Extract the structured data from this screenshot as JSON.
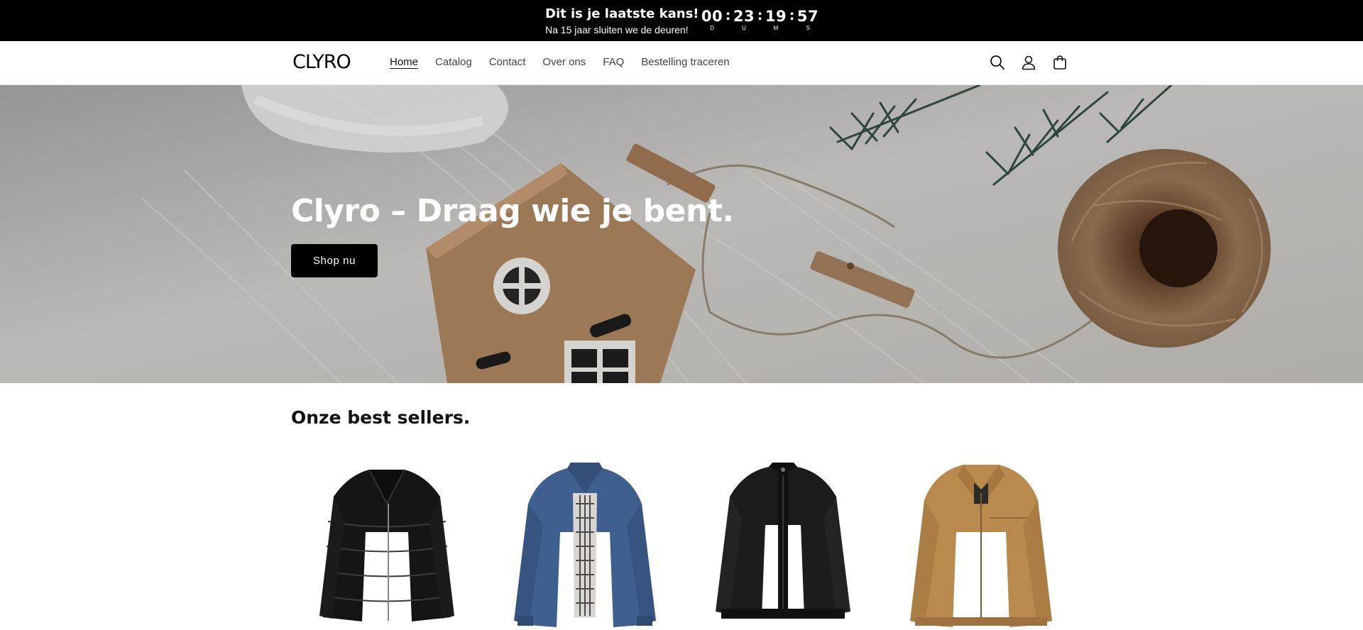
{
  "announcement": {
    "title": "Dit is je laatste kans!",
    "subtitle": "Na 15 jaar sluiten we de deuren!",
    "countdown": [
      {
        "value": "00",
        "label": "D"
      },
      {
        "value": "23",
        "label": "U"
      },
      {
        "value": "19",
        "label": "M"
      },
      {
        "value": "57",
        "label": "S"
      }
    ],
    "separator": ":"
  },
  "header": {
    "logo": "CLYRO",
    "nav": [
      "Home",
      "Catalog",
      "Contact",
      "Over ons",
      "FAQ",
      "Bestelling traceren"
    ],
    "active_nav": "Home",
    "icons": [
      "search-icon",
      "account-icon",
      "cart-icon"
    ]
  },
  "hero": {
    "title": "Clyro – Draag wie je bent.",
    "button": "Shop nu"
  },
  "bestsellers": {
    "title": "Onze best sellers.",
    "products": [
      {
        "name": "black-puffer-jacket",
        "color": "#151515"
      },
      {
        "name": "blue-bomber-jacket",
        "color": "#3f5f8e"
      },
      {
        "name": "black-bomber-jacket",
        "color": "#1c1c1c"
      },
      {
        "name": "tan-harrington-jacket",
        "color": "#b88a4e"
      }
    ]
  },
  "colors": {
    "announcement_bg": "#000000",
    "button_bg": "#000000",
    "text": "#121212"
  }
}
